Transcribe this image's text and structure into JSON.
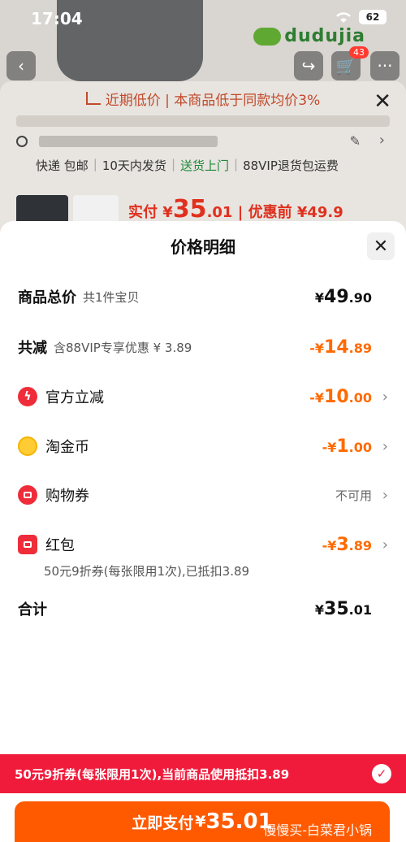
{
  "status_bar": {
    "time": "17:04",
    "battery": "62"
  },
  "background": {
    "logo_text": "dudujia",
    "cart_count": "43",
    "low_price_banner": "近期低价 | 本商品低于同款均价3%",
    "delivery": {
      "express": "快递 包邮",
      "ship": "10天内发货",
      "door": "送货上门",
      "vip_return": "88VIP退货包运费"
    },
    "product_price": {
      "paid_label": "实付",
      "paid_currency": "¥",
      "paid_int": "35",
      "paid_dec": ".01",
      "before_label": "| 优惠前",
      "before_price": "¥49.9"
    }
  },
  "sheet": {
    "title": "价格明细",
    "total_goods": {
      "label": "商品总价",
      "sub": "共1件宝贝",
      "currency": "¥",
      "int": "49",
      "dec": ".90"
    },
    "total_reduce": {
      "label": "共减",
      "sub": "含88VIP专享优惠 ¥ 3.89",
      "prefix": "-¥",
      "int": "14",
      "dec": ".89"
    },
    "items": [
      {
        "label": "官方立减",
        "icon": "bolt-icon",
        "prefix": "-¥",
        "int": "10",
        "dec": ".00"
      },
      {
        "label": "淘金币",
        "icon": "gold-coin-icon",
        "prefix": "-¥",
        "int": "1",
        "dec": ".00"
      },
      {
        "label": "购物券",
        "icon": "coupon-icon",
        "value": "不可用"
      },
      {
        "label": "红包",
        "icon": "red-packet-icon",
        "prefix": "-¥",
        "int": "3",
        "dec": ".89"
      }
    ],
    "hongbao_note": "50元9折券(每张限用1次),已抵扣3.89",
    "sum": {
      "label": "合计",
      "currency": "¥",
      "int": "35",
      "dec": ".01"
    }
  },
  "promo_bar": {
    "text": "50元9折券(每张限用1次),当前商品使用抵扣3.89"
  },
  "pay_button": {
    "label": "立即支付",
    "currency": "¥",
    "amount": "35.01",
    "watermark": "慢慢买-白菜君小锅"
  },
  "colors": {
    "accent_orange": "#ff5a00",
    "promo_red": "#f01b3b",
    "discount_orange": "#ff6a00"
  }
}
